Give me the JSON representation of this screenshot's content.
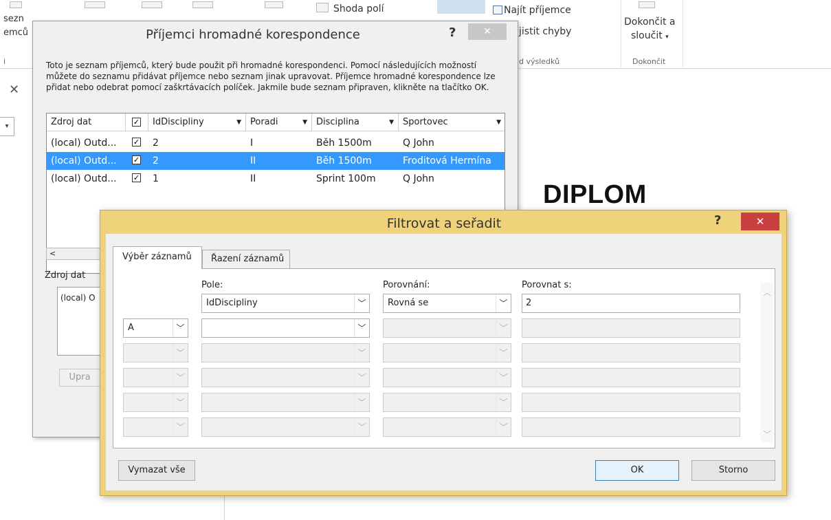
{
  "ribbon": {
    "labels": [
      "sezn",
      "emců",
      "i",
      "Shoda polí",
      "Najít příjemce",
      "jistit chyby",
      "d výsledků",
      "Dokončit a",
      "sloučit",
      "Dokončit"
    ]
  },
  "document": {
    "heading": "DIPLOM"
  },
  "recipients_dialog": {
    "title": "Příjemci hromadné korespondence",
    "help": "?",
    "close": "✕",
    "description": "Toto je seznam příjemců, který bude použit při hromadné korespondenci. Pomocí následujících možností můžete do seznamu přidávat příjemce nebo seznam jinak upravovat. Příjemce hromadné korespondence lze přidat nebo odebrat pomocí zaškrtávacích políček. Jakmile bude seznam připraven, klikněte na tlačítko OK.",
    "columns": [
      "Zdroj dat",
      "IdDiscipliny",
      "Poradi",
      "Disciplina",
      "Sportovec"
    ],
    "rows": [
      {
        "source": "(local) Outd...",
        "checked": true,
        "id": "2",
        "poradi": "I",
        "disciplina": "Běh 1500m",
        "sportovec": "Q John",
        "selected": false
      },
      {
        "source": "(local) Outd...",
        "checked": true,
        "id": "2",
        "poradi": "II",
        "disciplina": "Běh 1500m",
        "sportovec": "Froditová Hermína",
        "selected": true
      },
      {
        "source": "(local) Outd...",
        "checked": true,
        "id": "1",
        "poradi": "II",
        "disciplina": "Sprint 100m",
        "sportovec": "Q John",
        "selected": false
      }
    ],
    "source_label": "Zdroj dat",
    "source_item": "(local) O",
    "edit_button": "Upra"
  },
  "filter_dialog": {
    "title": "Filtrovat a seřadit",
    "help": "?",
    "close": "✕",
    "tabs": [
      "Výběr záznamů",
      "Řazení záznamů"
    ],
    "col_field": "Pole:",
    "col_compare": "Porovnání:",
    "col_value": "Porovnat s:",
    "rows": [
      {
        "conj": "",
        "field": "IdDiscipliny",
        "compare": "Rovná se",
        "value": "2"
      },
      {
        "conj": "A",
        "field": "",
        "compare": "",
        "value": ""
      },
      {
        "conj": "",
        "field": "",
        "compare": "",
        "value": ""
      },
      {
        "conj": "",
        "field": "",
        "compare": "",
        "value": ""
      },
      {
        "conj": "",
        "field": "",
        "compare": "",
        "value": ""
      },
      {
        "conj": "",
        "field": "",
        "compare": "",
        "value": ""
      }
    ],
    "clear_all": "Vymazat vše",
    "ok": "OK",
    "cancel": "Storno"
  }
}
